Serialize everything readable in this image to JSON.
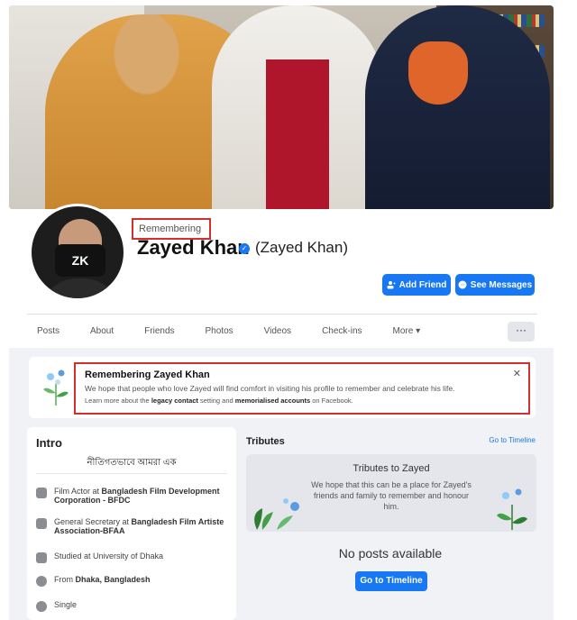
{
  "profile": {
    "remembering_label": "Remembering",
    "name": "Zayed Khan",
    "alternate_name": "(Zayed Khan)",
    "verified_icon": "verified-check-icon",
    "avatar_text": "ZK"
  },
  "actions": {
    "add_friend": "Add Friend",
    "see_messages": "See Messages"
  },
  "tabs": [
    "Posts",
    "About",
    "Friends",
    "Photos",
    "Videos",
    "Check-ins",
    "More"
  ],
  "more_label": "···",
  "memorial": {
    "title": "Remembering Zayed Khan",
    "text": "We hope that people who love Zayed will find comfort in visiting his profile to remember and celebrate his life.",
    "learn_prefix": "Learn more about the ",
    "legacy_contact": "legacy contact",
    "learn_middle": " setting and ",
    "memorialised_accounts": "memorialised accounts",
    "learn_suffix": " on Facebook."
  },
  "intro": {
    "title": "Intro",
    "bio": "নীতিগতভাবে আমরা এক",
    "items": [
      {
        "prefix": "Film Actor at ",
        "bold": "Bangladesh Film Development Corporation - BFDC",
        "icon": "briefcase-icon"
      },
      {
        "prefix": "General Secretary at ",
        "bold": "Bangladesh Film Artiste Association-BFAA",
        "icon": "briefcase-icon"
      },
      {
        "prefix": "Studied at University of Dhaka",
        "bold": "",
        "icon": "graduation-cap-icon"
      },
      {
        "prefix": "From ",
        "bold": "Dhaka, Bangladesh",
        "icon": "location-pin-icon"
      },
      {
        "prefix": "Single",
        "bold": "",
        "icon": "heart-icon"
      }
    ]
  },
  "tributes": {
    "title": "Tributes",
    "go_to_timeline_link": "Go to Timeline",
    "card_title": "Tributes to Zayed",
    "card_text": "We hope that this can be a place for Zayed's friends and family to remember and honour him.",
    "no_posts": "No posts available",
    "go_to_timeline_button": "Go to Timeline"
  },
  "colors": {
    "accent": "#1877f2",
    "highlight_border": "#d32f2f",
    "background": "#f0f2f5"
  }
}
